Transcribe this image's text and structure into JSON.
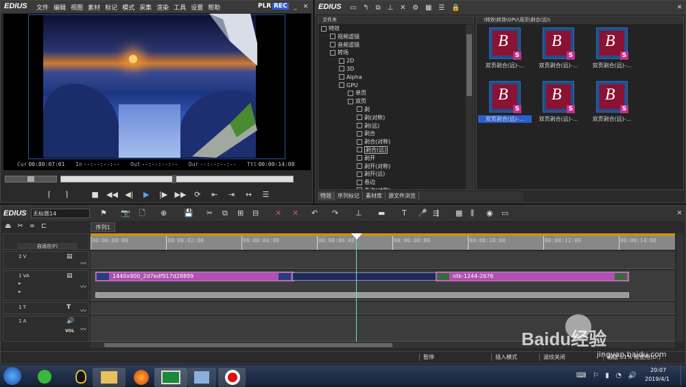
{
  "app": {
    "name": "EDIUS"
  },
  "menu": [
    "文件",
    "编辑",
    "视图",
    "素材",
    "标记",
    "模式",
    "采集",
    "渲染",
    "工具",
    "设置",
    "帮助"
  ],
  "player": {
    "plr": "PLR",
    "rec": "REC",
    "cur_label": "Cur",
    "cur": "00:00:07:01",
    "in_label": "In",
    "in": "--:--:--:--",
    "out_label": "Out",
    "out": "--:--:--:--",
    "dur_label": "Dur",
    "dur": "--:--:--:--",
    "ttl_label": "Ttl",
    "ttl": "00:00:14:08"
  },
  "bin": {
    "title": "EDIUS",
    "tree_header": "文件夹",
    "path": "\\特效\\转场\\GPU\\双页\\剥合(远)\\",
    "tree": [
      "特效",
      "视频滤镜",
      "音频滤镜",
      "转场",
      "2D",
      "3D",
      "Alpha",
      "GPU",
      "单页",
      "双页",
      "剥",
      "剥(对称)",
      "剥(远)",
      "剥合",
      "剥合(对称)",
      "剥合(远)",
      "剥开",
      "剥开(对称)",
      "剥开(远)",
      "卷边",
      "卷边(对称)"
    ],
    "thumbs": [
      "双页剥合(远)-...",
      "双页剥合(远)-...",
      "双页剥合(远)-...",
      "双页剥合(远)-...",
      "双页剥合(远)-...",
      "双页剥合(远)-..."
    ],
    "tabs": [
      "特效",
      "序列标记",
      "素材库",
      "源文件浏览"
    ]
  },
  "timeline": {
    "title": "EDIUS",
    "project": "无标题14",
    "sequence_tab": "序列1",
    "mode": "自适应(F)",
    "ruler": [
      "00:00:00:00",
      "00:00:02:00",
      "00:00:04:00",
      "00:00:06:00",
      "00:00:08:00",
      "00:00:10:00",
      "00:00:12:00",
      "00:00:14:00"
    ],
    "tracks": {
      "v2": "2 V",
      "va1": "1 VA",
      "t1": "1 T",
      "a1": "1 A",
      "vol": "VOL"
    },
    "clip1": "1440x900_2d7edf917d28899",
    "clip2": "ntk-1244-2676"
  },
  "status": {
    "pause": "暂停",
    "insert": "插入模式",
    "ripple": "波纹关闭",
    "disk": "磁盘:61% 被使用(D:)"
  },
  "taskbar": {
    "time": "20:07",
    "date": "2019/4/1"
  },
  "watermark": {
    "text": "Baidu经验",
    "url": "jingyan.baidu.com"
  }
}
